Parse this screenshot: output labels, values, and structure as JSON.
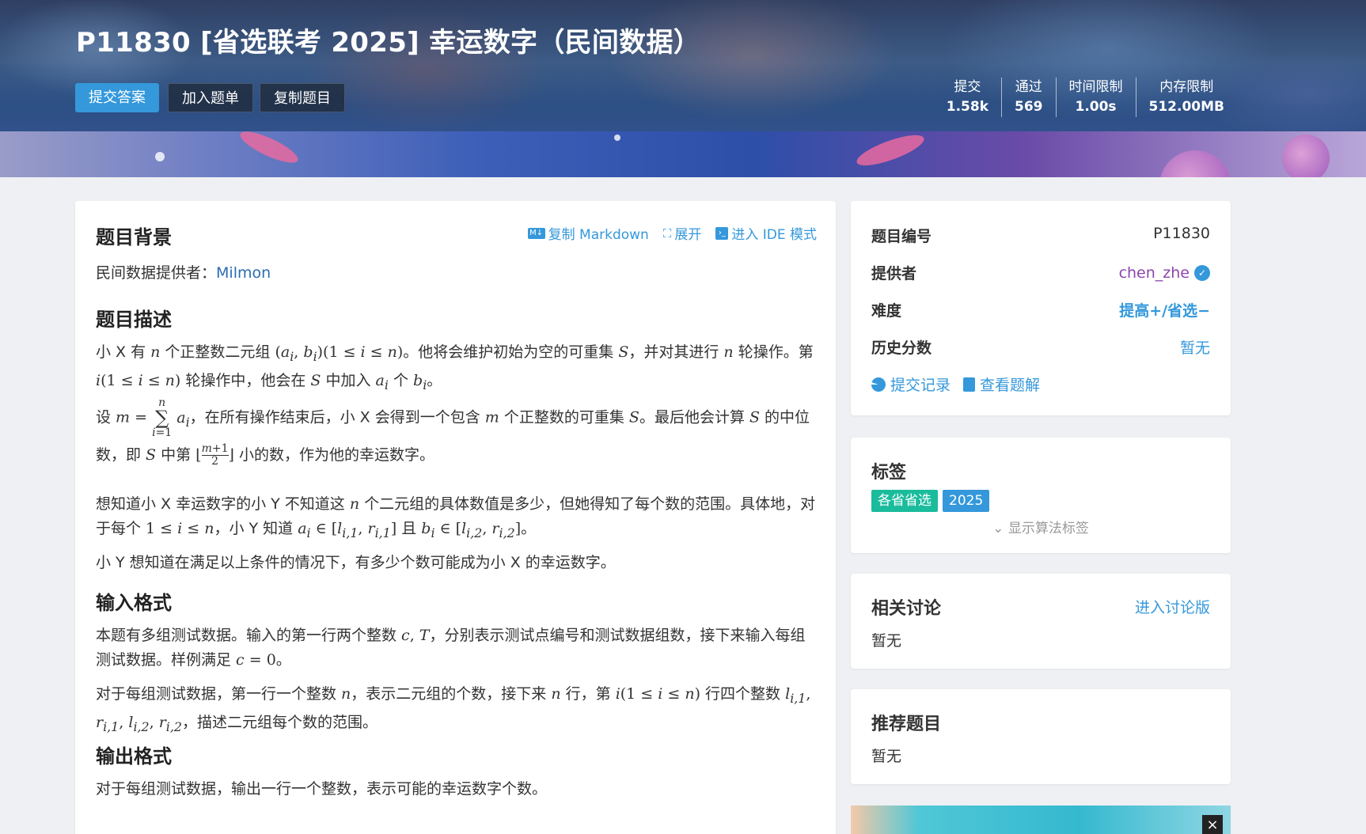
{
  "header": {
    "title": "P11830 [省选联考 2025] 幸运数字（民间数据）",
    "buttons": {
      "submit": "提交答案",
      "add_list": "加入题单",
      "copy": "复制题目"
    },
    "stats": [
      {
        "label": "提交",
        "value": "1.58k"
      },
      {
        "label": "通过",
        "value": "569"
      },
      {
        "label": "时间限制",
        "value": "1.00s"
      },
      {
        "label": "内存限制",
        "value": "512.00MB"
      }
    ]
  },
  "toolbar": {
    "copy_md": "复制 Markdown",
    "expand": "展开",
    "ide": "进入 IDE 模式"
  },
  "problem": {
    "bg_title": "题目背景",
    "bg_prefix": "民间数据提供者：",
    "bg_provider": "Milmon",
    "desc_title": "题目描述",
    "input_title": "输入格式",
    "output_title": "输出格式",
    "output_text": "对于每组测试数据，输出一行一个整数，表示可能的幸运数字个数。",
    "p3_text": "小 Y 想知道在满足以上条件的情况下，有多少个数可能成为小 X 的幸运数字。"
  },
  "info": {
    "id_label": "题目编号",
    "id_value": "P11830",
    "provider_label": "提供者",
    "provider_value": "chen_zhe",
    "difficulty_label": "难度",
    "difficulty_value": "提高+/省选−",
    "history_label": "历史分数",
    "history_value": "暂无",
    "submissions_link": "提交记录",
    "solutions_link": "查看题解"
  },
  "tags": {
    "title": "标签",
    "items": [
      "各省省选",
      "2025"
    ],
    "show_algo": "显示算法标签"
  },
  "discussion": {
    "title": "相关讨论",
    "link": "进入讨论版",
    "empty": "暂无"
  },
  "recommend": {
    "title": "推荐题目",
    "empty": "暂无"
  },
  "colors": {
    "accent": "#3498db",
    "provider": "#8e44ad",
    "tag_province": "#1abc9c",
    "tag_year": "#3498db"
  }
}
